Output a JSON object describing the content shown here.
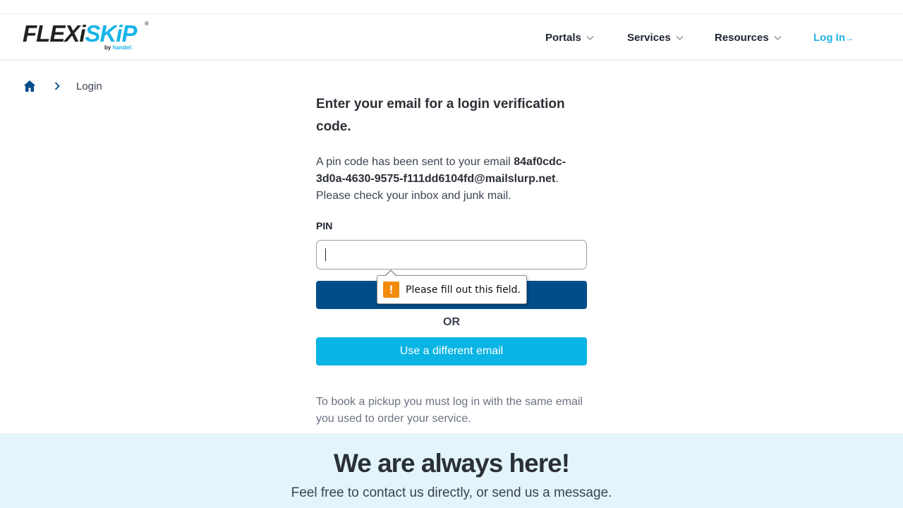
{
  "brand": {
    "logo_main": "FLEXi",
    "logo_accent": "SKiP",
    "logo_reg": "®",
    "logo_by": "by",
    "logo_company": "handel:",
    "colors": {
      "dark": "#222222",
      "accent": "#18b4e6",
      "primary_button": "#004d8a",
      "secondary_button": "#0ab4e4",
      "footer_bg": "#e3f5fb",
      "warning": "#f28b0c"
    }
  },
  "nav": {
    "items": [
      {
        "label": "Portals",
        "icon": "chevron-down-icon"
      },
      {
        "label": "Services",
        "icon": "chevron-down-icon"
      },
      {
        "label": "Resources",
        "icon": "chevron-down-icon"
      }
    ],
    "login_label": "Log In",
    "login_arrow": "→"
  },
  "breadcrumb": {
    "home_icon": "home-icon",
    "separator_icon": "chevron-right-icon",
    "current": "Login"
  },
  "form": {
    "title": "Enter your email for a login verification code.",
    "desc_prefix": "A pin code has been sent to your email ",
    "email": "84af0cdc-3d0a-4630-9575-f111dd6104fd@mailslurp.net",
    "desc_suffix": ". Please check your inbox and junk mail.",
    "pin_label": "PIN",
    "pin_value": "",
    "submit_label": "",
    "or_label": "OR",
    "different_email_label": "Use a different email",
    "note": "To book a pickup you must log in with the same email you used to order your service."
  },
  "validation_tooltip": {
    "icon": "warning-icon",
    "icon_glyph": "!",
    "message": "Please fill out this field."
  },
  "footer": {
    "title": "We are always here!",
    "subtitle": "Feel free to contact us directly, or send us a message."
  }
}
